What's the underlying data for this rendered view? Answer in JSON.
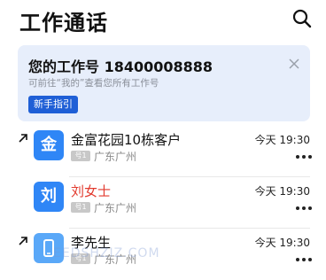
{
  "header": {
    "title": "工作通话"
  },
  "banner": {
    "title": "您的工作号 18400008888",
    "subtitle": "可前往“我的”查看您所有工作号",
    "guide_button": "新手指引"
  },
  "calls": [
    {
      "avatar_text": "金",
      "name": "金富花园10栋客户",
      "badge": "号1",
      "location": "广东广州",
      "time": "今天 19:30",
      "outgoing": true
    },
    {
      "avatar_text": "刘",
      "name": "刘女士",
      "badge": "号1",
      "location": "广东广州",
      "time": "今天 19:30",
      "outgoing": false,
      "name_color": "#e23a2e"
    },
    {
      "avatar_icon": "phone-icon",
      "name": "李先生",
      "badge": "号1",
      "location": "广东广州",
      "time": "今天 19:30",
      "outgoing": true
    }
  ],
  "watermark": "EEDSHZIZ.COM",
  "colors": {
    "accent": "#1f5fd6",
    "banner_bg": "#e7eefb",
    "avatar": "#2f86f6"
  }
}
